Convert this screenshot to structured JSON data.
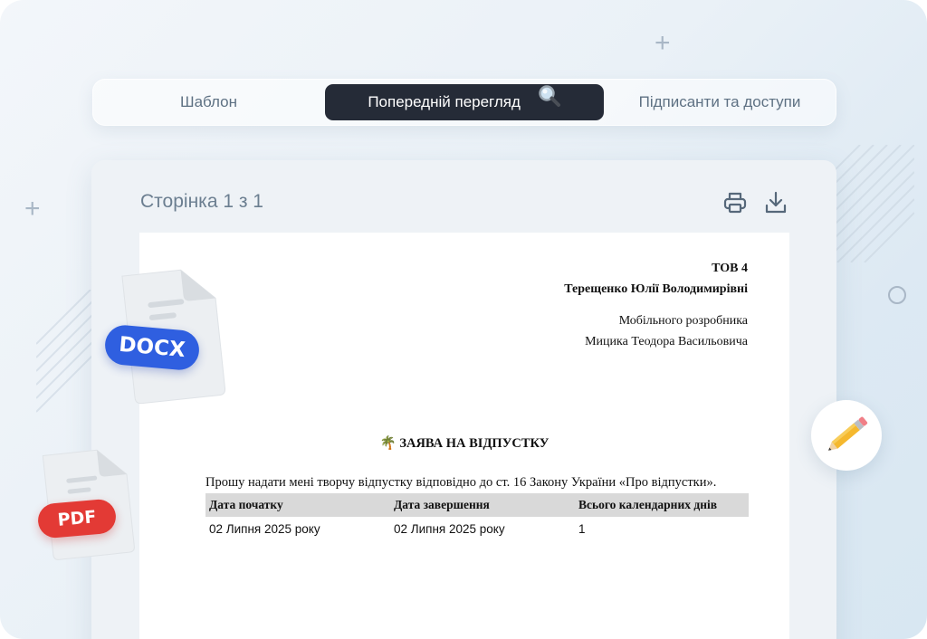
{
  "tabs": [
    {
      "label": "Шаблон"
    },
    {
      "label": "Попередній перегляд"
    },
    {
      "label": "Підписанти та доступи"
    }
  ],
  "viewer": {
    "page_counter": "Сторінка 1 з 1"
  },
  "document": {
    "company": "ТОВ 4",
    "recipient_name": "Терещенко Юлії Володимирівні",
    "sender_position": "Мобільного розробника",
    "sender_name": "Мицика Теодора Васильовича",
    "title_emoji": "🌴",
    "title": "ЗАЯВА НА ВІДПУСТКУ",
    "body": "Прошу надати мені творчу відпустку відповідно до ст. 16 Закону України «Про відпустки».",
    "table": {
      "headers": [
        "Дата початку",
        "Дата завершення",
        "Всього календарних днів"
      ],
      "rows": [
        [
          "02 Липня 2025 року",
          "02 Липня 2025 року",
          "1"
        ]
      ]
    }
  },
  "file_badges": {
    "docx": "DOCX",
    "pdf": "PDF"
  },
  "colors": {
    "active_tab_bg": "#252b37",
    "docx_badge": "#2f5fe0",
    "pdf_badge": "#e33a35"
  }
}
